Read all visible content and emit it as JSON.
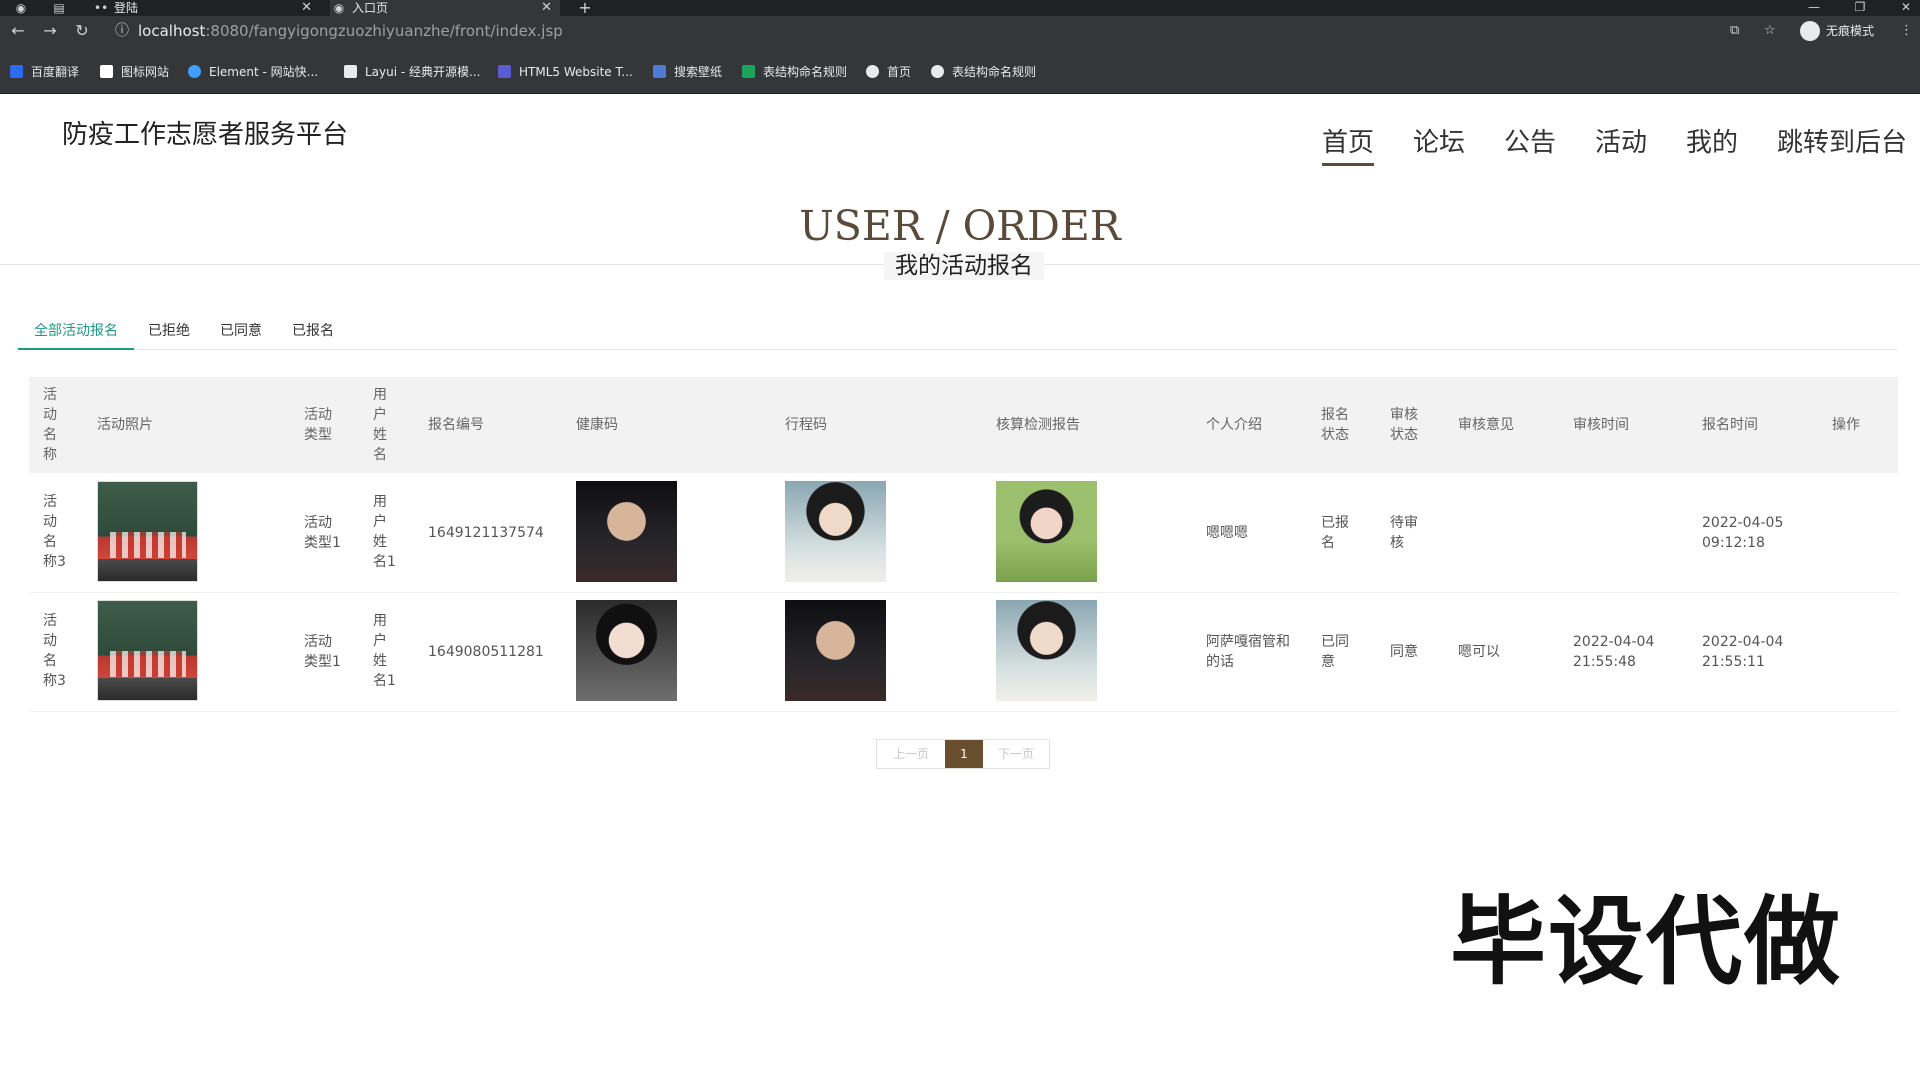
{
  "browser": {
    "tabs": [
      {
        "label": "登陆"
      },
      {
        "label": "入口页"
      }
    ],
    "address": {
      "host": "localhost",
      "path": ":8080/fangyigongzuozhiyuanzhe/front/index.jsp"
    },
    "incognito_label": "无痕模式",
    "bookmarks": [
      {
        "label": "百度翻译",
        "color": "#2c6bed"
      },
      {
        "label": "图标网站",
        "color": "#ffffff"
      },
      {
        "label": "Element - 网站快...",
        "color": "#409eff"
      },
      {
        "label": "Layui - 经典开源模...",
        "color": "#e8eaed"
      },
      {
        "label": "HTML5 Website T...",
        "color": "#5b5bd6"
      },
      {
        "label": "搜索壁纸",
        "color": "#4f7ad6"
      },
      {
        "label": "表结构命名规则",
        "color": "#1aa55a"
      },
      {
        "label": "首页",
        "color": "#e8eaed"
      },
      {
        "label": "表结构命名规则",
        "color": "#e8eaed"
      }
    ]
  },
  "site": {
    "title": "防疫工作志愿者服务平台",
    "nav": [
      {
        "label": "首页",
        "active": true
      },
      {
        "label": "论坛"
      },
      {
        "label": "公告"
      },
      {
        "label": "活动"
      },
      {
        "label": "我的"
      },
      {
        "label": "跳转到后台"
      }
    ]
  },
  "hero": {
    "title": "USER / ORDER",
    "subtitle": "我的活动报名"
  },
  "subtabs": [
    {
      "label": "全部活动报名",
      "active": true
    },
    {
      "label": "已拒绝"
    },
    {
      "label": "已同意"
    },
    {
      "label": "已报名"
    }
  ],
  "table": {
    "headers": {
      "activity_name": "活\n动\n名\n称",
      "activity_photo": "活动照片",
      "activity_type": "活动\n类型",
      "user_name": "用\n户\n姓\n名",
      "signup_no": "报名编号",
      "health_code": "健康码",
      "trip_code": "行程码",
      "nucleic_report": "核算检测报告",
      "intro": "个人介绍",
      "signup_status": "报名\n状态",
      "review_status": "审核\n状态",
      "review_opinion": "审核意见",
      "review_time": "审核时间",
      "signup_time": "报名时间",
      "action": "操作"
    },
    "rows": [
      {
        "activity_name": "活\n动\n名\n称3",
        "activity_type": "活动\n类型1",
        "user_name": "用\n户\n姓\n名1",
        "signup_no": "1649121137574",
        "health_code_photo": "young-man-portrait",
        "trip_code_photo": "woman-ponytail-portrait",
        "nucleic_report_photo": "woman-green-sweater-portrait",
        "intro": "嗯嗯嗯",
        "signup_status": "已报\n名",
        "review_status": "待审\n核",
        "review_opinion": "",
        "review_time": "",
        "signup_time": "2022-04-05\n09:12:18"
      },
      {
        "activity_name": "活\n动\n名\n称3",
        "activity_type": "活动\n类型1",
        "user_name": "用\n户\n姓\n名1",
        "signup_no": "1649080511281",
        "health_code_photo": "woman-short-hair-portrait",
        "trip_code_photo": "young-man-portrait",
        "nucleic_report_photo": "woman-ponytail-portrait",
        "intro": "阿萨嘎宿管和\n的话",
        "signup_status": "已同\n意",
        "review_status": "同意",
        "review_opinion": "嗯可以",
        "review_time": "2022-04-04\n21:55:48",
        "signup_time": "2022-04-04\n21:55:11"
      }
    ]
  },
  "pager": {
    "prev": "上一页",
    "current": "1",
    "next": "下一页"
  },
  "watermark": "毕设代做",
  "colors": {
    "accent_green": "#1d9a83",
    "brand_brown": "#6a4f2e",
    "title_brown": "#5a4a3a"
  }
}
